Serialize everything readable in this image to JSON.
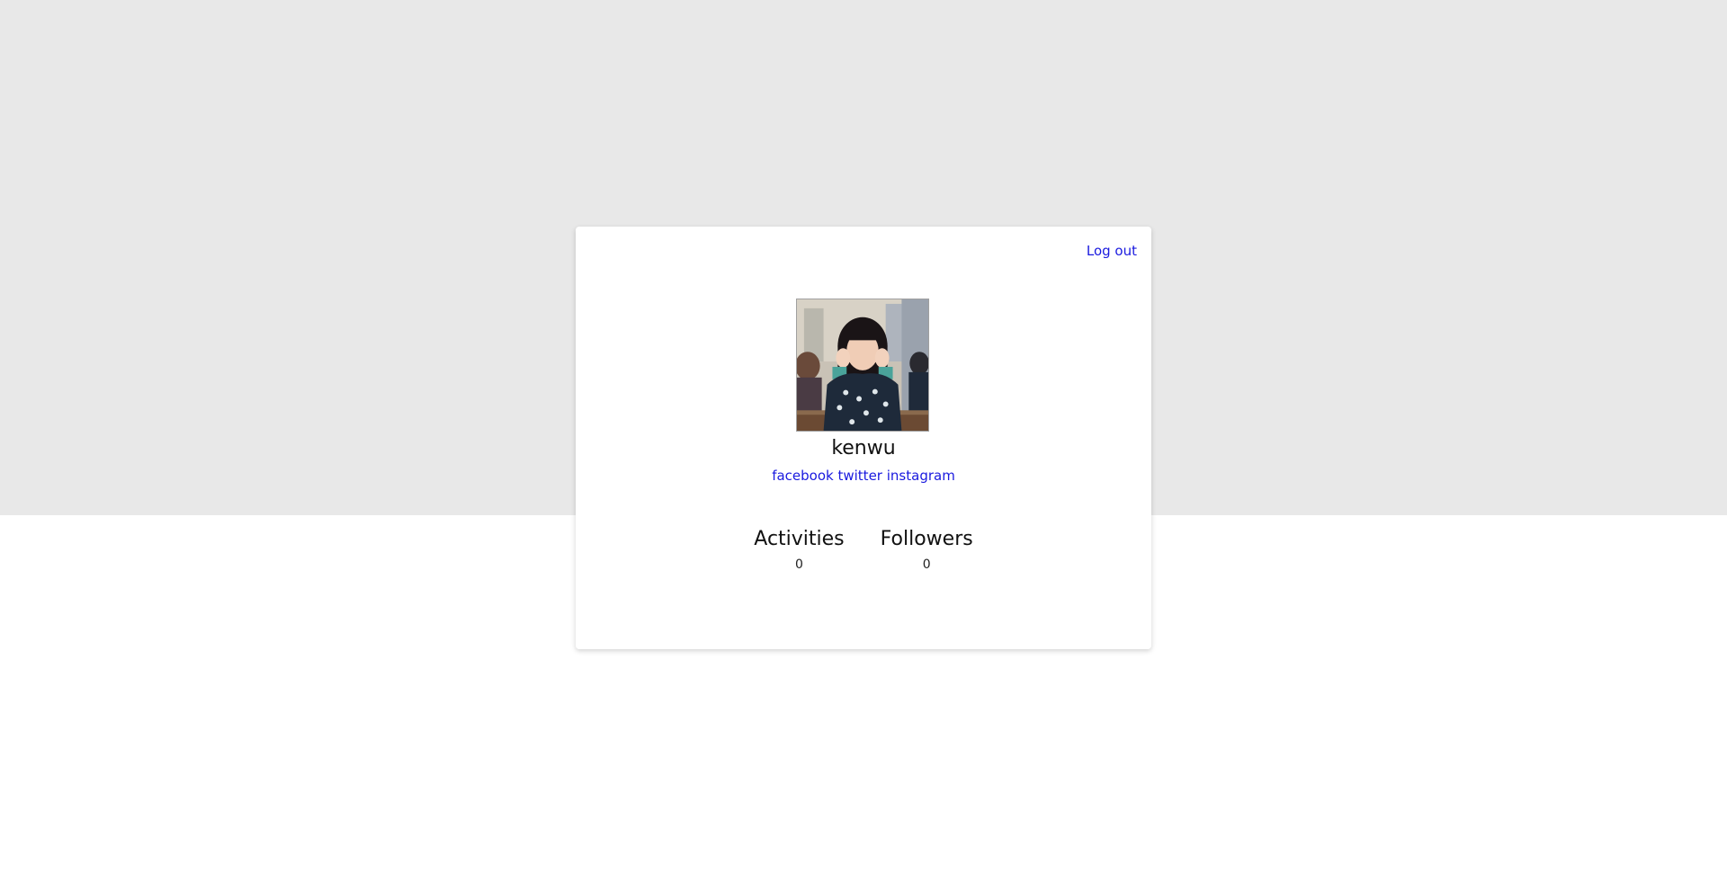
{
  "header": {
    "logout_label": "Log out"
  },
  "profile": {
    "username": "kenwu",
    "avatar_description_icon": "profile-photo",
    "socials": [
      {
        "label": "facebook"
      },
      {
        "label": "twitter"
      },
      {
        "label": "instagram"
      }
    ]
  },
  "stats": [
    {
      "label": "Activities",
      "value": "0"
    },
    {
      "label": "Followers",
      "value": "0"
    }
  ],
  "colors": {
    "top_band": "#e8e8e8",
    "link": "#1a1adf",
    "card": "#ffffff"
  }
}
